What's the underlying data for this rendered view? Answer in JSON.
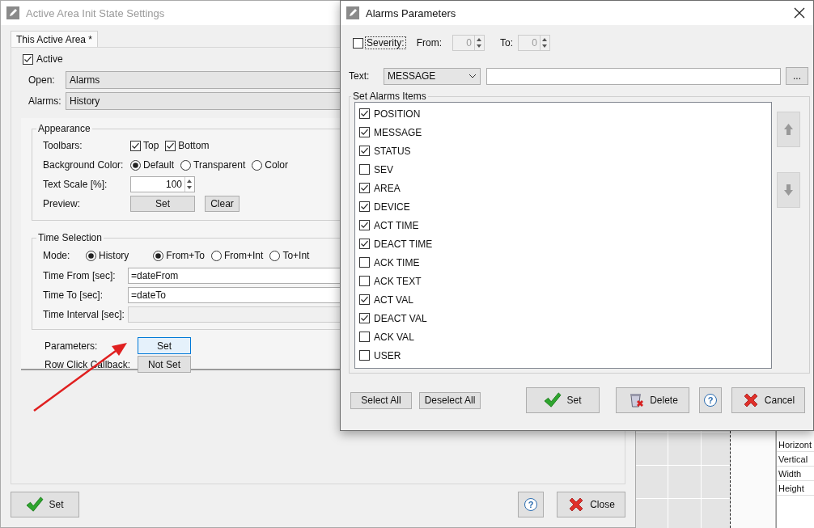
{
  "main_window": {
    "title": "Active Area Init State Settings",
    "tabs": [
      {
        "label": "This Active Area *",
        "selected": true
      }
    ],
    "active": {
      "label": "Active",
      "checked": true
    },
    "fields": [
      {
        "label": "Open:",
        "value": "Alarms"
      },
      {
        "label": "Alarms:",
        "value": "History"
      }
    ],
    "appearance": {
      "title": "Appearance",
      "toolbars_label": "Toolbars:",
      "toolbars": [
        {
          "label": "Top",
          "checked": true
        },
        {
          "label": "Bottom",
          "checked": true
        }
      ],
      "background_label": "Background Color:",
      "background_options": [
        {
          "label": "Default",
          "selected": true
        },
        {
          "label": "Transparent",
          "selected": false
        },
        {
          "label": "Color",
          "selected": false
        }
      ],
      "text_scale_label": "Text Scale [%]:",
      "text_scale": "100",
      "preview_label": "Preview:",
      "preview_buttons": [
        "Set",
        "Clear"
      ]
    },
    "time_selection": {
      "title": "Time Selection",
      "mode_label": "Mode:",
      "history": {
        "label": "History",
        "selected": true
      },
      "modes": [
        {
          "label": "From+To",
          "selected": true
        },
        {
          "label": "From+Int",
          "selected": false
        },
        {
          "label": "To+Int",
          "selected": false
        }
      ],
      "fields": [
        {
          "label": "Time From [sec]:",
          "value": "=dateFrom",
          "disabled": false
        },
        {
          "label": "Time To [sec]:",
          "value": "=dateTo",
          "disabled": false
        },
        {
          "label": "Time Interval [sec]:",
          "disabled": true
        }
      ]
    },
    "callbacks": [
      {
        "label": "Parameters:",
        "button": "Set",
        "highlighted": true
      },
      {
        "label": "Row Click Callback:",
        "button": "Not Set",
        "highlighted": false
      }
    ],
    "footer": {
      "set_button": "Set",
      "help_button": "?",
      "close_button": "Close"
    }
  },
  "alarms_dialog": {
    "title": "Alarms Parameters",
    "severity": {
      "label": "Severity:",
      "checked": false,
      "from_label": "From:",
      "from": "0",
      "to_label": "To:",
      "to": "0"
    },
    "text_label": "Text:",
    "text_combo": "MESSAGE",
    "browse_button": "...",
    "group_title": "Set Alarms Items",
    "items": [
      {
        "label": "POSITION",
        "checked": true
      },
      {
        "label": "MESSAGE",
        "checked": true
      },
      {
        "label": "STATUS",
        "checked": true
      },
      {
        "label": "SEV",
        "checked": false
      },
      {
        "label": "AREA",
        "checked": true
      },
      {
        "label": "DEVICE",
        "checked": true
      },
      {
        "label": "ACT TIME",
        "checked": true
      },
      {
        "label": "DEACT TIME",
        "checked": true
      },
      {
        "label": "ACK TIME",
        "checked": false
      },
      {
        "label": "ACK TEXT",
        "checked": false
      },
      {
        "label": "ACT VAL",
        "checked": true
      },
      {
        "label": "DEACT VAL",
        "checked": true
      },
      {
        "label": "ACK VAL",
        "checked": false
      },
      {
        "label": "USER",
        "checked": false
      }
    ],
    "select_all_button": "Select All",
    "deselect_all_button": "Deselect All",
    "set_button": "Set",
    "delete_button": "Delete",
    "help_button": "?",
    "cancel_button": "Cancel"
  },
  "property_panel": {
    "rows": [
      "Horizont",
      "Vertical",
      "Width",
      "Height"
    ]
  }
}
